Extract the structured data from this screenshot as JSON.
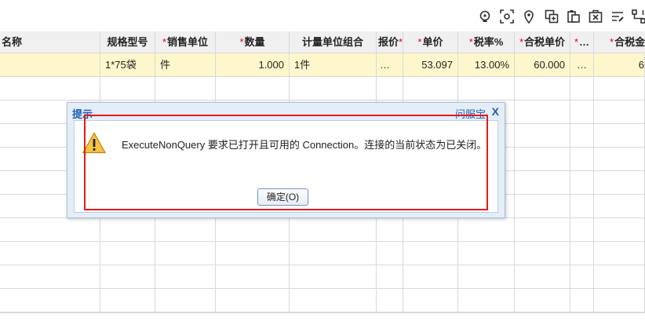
{
  "toolbar": {
    "icons": [
      "lightbulb-icon",
      "scan-icon",
      "location-icon",
      "copy-icon",
      "paste-icon",
      "clear-icon",
      "edit-icon",
      "flow-icon"
    ]
  },
  "grid": {
    "headers": {
      "name": "名称",
      "model": "规格型号",
      "sales_unit": "销售单位",
      "qty": "数量",
      "unit_combo": "计量单位组合",
      "quote": "报价",
      "price": "单价",
      "tax_rate": "税率%",
      "tax_price": "合税单价",
      "more": "…",
      "tax_amount": "合税金"
    },
    "row": {
      "model": "1*75袋",
      "sales_unit": "件",
      "qty": "1.000",
      "unit_combo": "1件",
      "quote": "…",
      "price": "53.097",
      "tax_rate": "13.00%",
      "tax_price": "60.000",
      "more": "…",
      "tax_amount": "6"
    }
  },
  "dialog": {
    "title": "提示",
    "help": "问服宝",
    "close": "X",
    "message": "ExecuteNonQuery 要求已打开且可用的 Connection。连接的当前状态为已关闭。",
    "ok_label": "确定(O)"
  },
  "colors": {
    "highlight_row": "#fff7cc",
    "required_mark": "#e60012",
    "annotation_box": "#e31b1b",
    "dialog_accent": "#1e5fb4"
  }
}
